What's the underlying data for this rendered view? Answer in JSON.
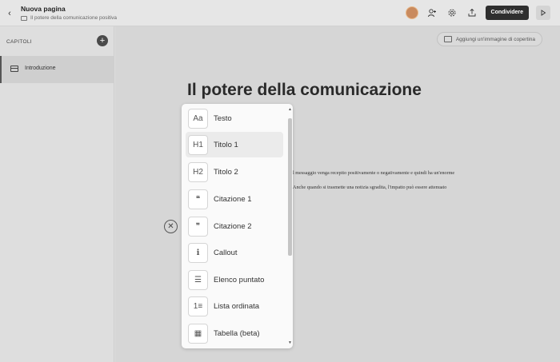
{
  "topbar": {
    "title": "Nuova pagina",
    "breadcrumb": "Il potere della comunicazione positiva",
    "share_label": "Condividere",
    "back_glyph": "‹",
    "icons": [
      "chevron-left-icon",
      "folder-icon",
      "avatar",
      "add-user-icon",
      "gear-icon",
      "export-icon",
      "play-icon"
    ],
    "colors": {
      "share_button": "#2f2f2f",
      "avatar": "#c98a5e"
    }
  },
  "sidebar": {
    "heading": "CAPITOLI",
    "add_glyph": "+",
    "items": [
      {
        "label": "Introduzione",
        "icon": "chapter-icon",
        "selected": true
      }
    ]
  },
  "main": {
    "cover_label": "Aggiungi un'immagine di copertina",
    "title": "Il potere della comunicazione",
    "lines": [
      "l messaggio venga recepito positivamente o negativamente e quindi ha un'enorme",
      "Anche quando si trasmette una notizia sgradita, l'impatto può essere attenuato"
    ],
    "close_glyph": "✕"
  },
  "block_menu": {
    "items": [
      {
        "label": "Testo",
        "icon": "text-icon",
        "glyph": "Aa"
      },
      {
        "label": "Titolo 1",
        "icon": "heading-1-icon",
        "glyph": "H1",
        "active": true
      },
      {
        "label": "Titolo 2",
        "icon": "heading-2-icon",
        "glyph": "H2"
      },
      {
        "label": "Citazione 1",
        "icon": "quote-1-icon",
        "glyph": "❝"
      },
      {
        "label": "Citazione 2",
        "icon": "quote-2-icon",
        "glyph": "❞"
      },
      {
        "label": "Callout",
        "icon": "callout-icon",
        "glyph": "ℹ"
      },
      {
        "label": "Elenco puntato",
        "icon": "bullet-list-icon",
        "glyph": "☰"
      },
      {
        "label": "Lista ordinata",
        "icon": "numbered-list-icon",
        "glyph": "1≡"
      },
      {
        "label": "Tabella (beta)",
        "icon": "table-icon",
        "glyph": "▦"
      }
    ],
    "scroll_up": "▲",
    "scroll_down": "▼"
  }
}
